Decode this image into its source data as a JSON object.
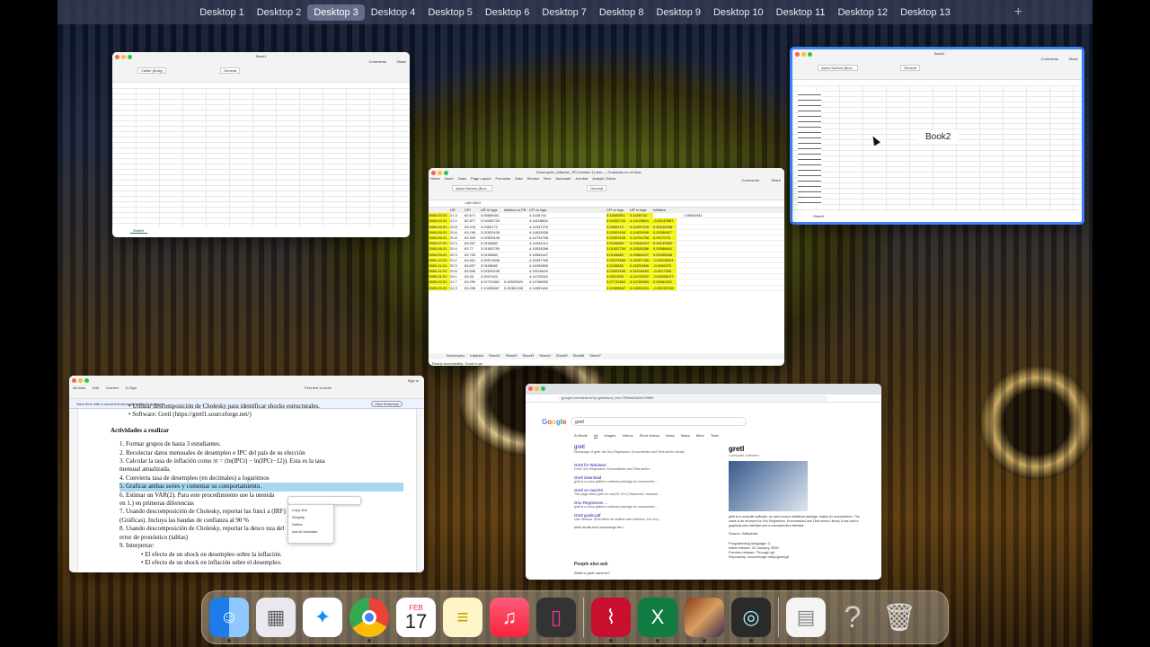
{
  "spaces": {
    "items": [
      "Desktop 1",
      "Desktop 2",
      "Desktop 3",
      "Desktop 4",
      "Desktop 5",
      "Desktop 6",
      "Desktop 7",
      "Desktop 8",
      "Desktop 9",
      "Desktop 10",
      "Desktop 11",
      "Desktop 12",
      "Desktop 13"
    ],
    "active": "Desktop 3",
    "add": "+"
  },
  "book1": {
    "title": "Book1",
    "font": "Calibri (Body)",
    "format": "General",
    "comments": "Comments",
    "share": "Share",
    "sheet": "Sheet1"
  },
  "book2": {
    "title": "Book2",
    "label": "Book2",
    "font": "Aptos Narrow (Bod...",
    "format": "General",
    "comments": "Comments",
    "share": "Share",
    "sheet": "Sheet1"
  },
  "excel_main": {
    "title": "Desempleo_Inflacion_PR (version 1).xlsx — Guardado en mi Mac",
    "tabs": [
      "Home",
      "Insert",
      "Draw",
      "Page Layout",
      "Formulas",
      "Data",
      "Review",
      "View",
      "Automate",
      "Acrobat",
      "Analytic Solver"
    ],
    "font": "Aptos Narrow (Bod...",
    "format": "General",
    "comments": "Comments",
    "share": "Share",
    "formula": "=A6+A5/4",
    "headers": [
      "",
      "UR",
      "CPI",
      "UR in logs",
      "inflation in PR",
      "CPI in logs",
      "",
      "",
      "",
      "",
      "",
      "",
      "CPI in logs",
      "UR in logs",
      "Inflation",
      "",
      ""
    ],
    "rows": [
      [
        "1984-02-01",
        "21.3",
        "62.671",
        "3.05806311",
        "",
        "4.1426743",
        "",
        "",
        "",
        "",
        "",
        "",
        "3.14840511",
        "4.1426743",
        "",
        "",
        "1.58040511"
      ],
      [
        "1984-03-01",
        "21.0",
        "62.877",
        "3.04452734",
        "",
        "4.14118564",
        "",
        "",
        "",
        "",
        "",
        "",
        "3.04452734",
        "4.14118564",
        "-0.00149387",
        ""
      ],
      [
        "1984-04-01",
        "20.8",
        "63.015",
        "3.0350172",
        "",
        "4.14337276",
        "",
        "",
        "",
        "",
        "",
        "",
        "3.0350172",
        "4.14337276",
        "0.00219236",
        ""
      ],
      [
        "1984-05-01",
        "20.6",
        "63.196",
        "3.02529108",
        "",
        "4.14625936",
        "",
        "",
        "",
        "",
        "",
        "",
        "3.02529108",
        "4.14625936",
        "0.00286817",
        ""
      ],
      [
        "1984-06-01",
        "20.6",
        "63.303",
        "3.02529108",
        "",
        "4.14794758",
        "",
        "",
        "",
        "",
        "",
        "",
        "3.02529108",
        "4.14794758",
        "0.0017278",
        ""
      ],
      [
        "1984-07-01",
        "20.3",
        "63.397",
        "3.0106883",
        "",
        "4.14944214",
        "",
        "",
        "",
        "",
        "",
        "",
        "3.0106883",
        "4.14944214",
        "0.00149382",
        ""
      ],
      [
        "1984-08-01",
        "20.4",
        "63.77",
        "3.01552759",
        "",
        "4.15528286",
        "",
        "",
        "",
        "",
        "",
        "",
        "3.01552759",
        "4.15528286",
        "0.00586641",
        ""
      ],
      [
        "1984-09-01",
        "20.3",
        "63.793",
        "3.0106883",
        "",
        "4.15564447",
        "",
        "",
        "",
        "",
        "",
        "",
        "3.0106883",
        "4.15564447",
        "0.00036098",
        ""
      ],
      [
        "1984-10-01",
        "20.2",
        "63.661",
        "3.00574836",
        "",
        "4.15357765",
        "",
        "",
        "",
        "",
        "",
        "",
        "3.00574836",
        "4.15357765",
        "-0.00206924",
        ""
      ],
      [
        "1984-11-01",
        "20.3",
        "63.607",
        "3.0106883",
        "",
        "4.15292806",
        "",
        "",
        "",
        "",
        "",
        "",
        "3.0106883",
        "4.15292806",
        "-0.0006375",
        ""
      ],
      [
        "1984-12-01",
        "20.6",
        "63.506",
        "3.02529108",
        "",
        "4.15116449",
        "",
        "",
        "",
        "",
        "",
        "",
        "3.02529108",
        "4.15116449",
        "-0.0017333",
        ""
      ],
      [
        "1985-01-01",
        "20.1",
        "63.26",
        "3.0007403",
        "",
        "4.14725322",
        "",
        "",
        "",
        "",
        "",
        "",
        "3.0007403",
        "4.14725322",
        "-0.00388127",
        ""
      ],
      [
        "1985-02-01",
        "21.7",
        "63.299",
        "3.07731862",
        "0.00539529",
        "4.14786953",
        "",
        "",
        "",
        "",
        "",
        "",
        "3.07731862",
        "4.14786953",
        "0.00061631",
        ""
      ],
      [
        "1985-03-01",
        "22.3",
        "63.206",
        "3.10458667",
        "0.00381245",
        "4.14551184",
        "",
        "",
        "",
        "",
        "",
        "",
        "3.10458667",
        "4.14551184",
        "-0.00235768",
        ""
      ]
    ],
    "sheets": [
      "Desempleo",
      "Inflación",
      "Sheet1",
      "Sheet2",
      "Sheet3",
      "Sheet4",
      "Sheet5",
      "Sheet6",
      "Sheet7"
    ],
    "status": "Ready  Accessibility: Good to go"
  },
  "pdf": {
    "app": "Preview",
    "toolbar": [
      "All tools",
      "Edit",
      "Convert",
      "E-Sign"
    ],
    "assistant": "Save time with a document summary using AI Assistant",
    "view_summary": "View Summary",
    "find": "Find text or tools",
    "sign_in": "Sign in",
    "bullets_top": [
      "Utilizar descomposición de Cholesky para identificar shocks estructurales.",
      "Software: Gretl (https://gretl1.sourceforge.net/)"
    ],
    "heading": "Actividades a realizar",
    "items": [
      "1. Formar grupos de hasta 3 estudiantes.",
      "2. Recolectar datos mensuales de desempleo e IPC del país de su elección",
      "3. Calcular la tasa de inflación como πt = (ln(IPCt) − ln(IPCt−12)). Esta es la tasa",
      "    mensual anualizada.",
      "4. Convierta tasa de desempleo (en decimales) a logaritmos",
      "5. Graficar ambas series y comentar su comportamiento.",
      "6. Estimar un VAR(2). Para este procedimiento use la                                      ntenida",
      "    en 1.) en primeras diferencias",
      "7. Usando descomposición de Cholesky, reportar las funci                               a (IRF)",
      "    (Gráficas). Incluya las bandas de confianza al 90 %",
      "8. Usando descomposición de Cholesky, reportar la desco                             nza del",
      "    error de pronóstico (tablas)",
      "9. Interpretar:"
    ],
    "sub": [
      "El efecto de un shock en desempleo sobre la inflación.",
      "El efecto de un shock en inflación sobre el desempleo."
    ],
    "menu": [
      "Copy text",
      "Simplify",
      "Define",
      "Ask AI Assistant"
    ]
  },
  "browser": {
    "url": "google.com/search?q=gretl&sca_esv=7f8fead3b2e1996f0",
    "query": "gretl",
    "tabs": [
      "AI Mode",
      "All",
      "Images",
      "Videos",
      "Short videos",
      "News",
      "Maps",
      "More",
      "Tools"
    ],
    "results": [
      {
        "title": "gretl",
        "desc": "Homepage of gretl, the Gnu Regression, Econometrics and Time-series Library."
      },
      {
        "title": "Gretl for Windows",
        "desc": "Gretl: Gnu Regression, Econometrics and Time-series ..."
      },
      {
        "title": "Gretl download",
        "desc": "gretl is a cross-platform software package for econometric ..."
      },
      {
        "title": "Gretl on macOS",
        "desc": "This page offers gretl for macOS 10.9 (\"Mavericks\" released ..."
      },
      {
        "title": "Gnu Regression ...",
        "desc": "gretl is a cross-platform software package for econometric ..."
      },
      {
        "title": "Gretl guide.pdf",
        "desc": "User Manual. Gretl offers an intuitive user interface; it is very ..."
      }
    ],
    "more": "More results from sourceforge.net »",
    "paa": "People also ask",
    "paa_q": "What is gretl used for?",
    "panel": {
      "title": "gretl",
      "sub": "Computer software",
      "desc": "gretl is a computer software, an open-source statistical package, mainly for econometrics. The name is an acronym for Gnu Regression, Econometrics and Time-series Library. It has both a graphical user interface and a command-line interface.",
      "source": "Source: Wikipedia",
      "lang": "Programming language: C",
      "release": "Initial release: 31 January 2000",
      "preview": "Preview release: Through git",
      "repo": "Repository: sourceforge.net/p/gretl/git"
    }
  },
  "dock": {
    "cal_month": "FEB",
    "cal_day": "17",
    "help": "?"
  }
}
